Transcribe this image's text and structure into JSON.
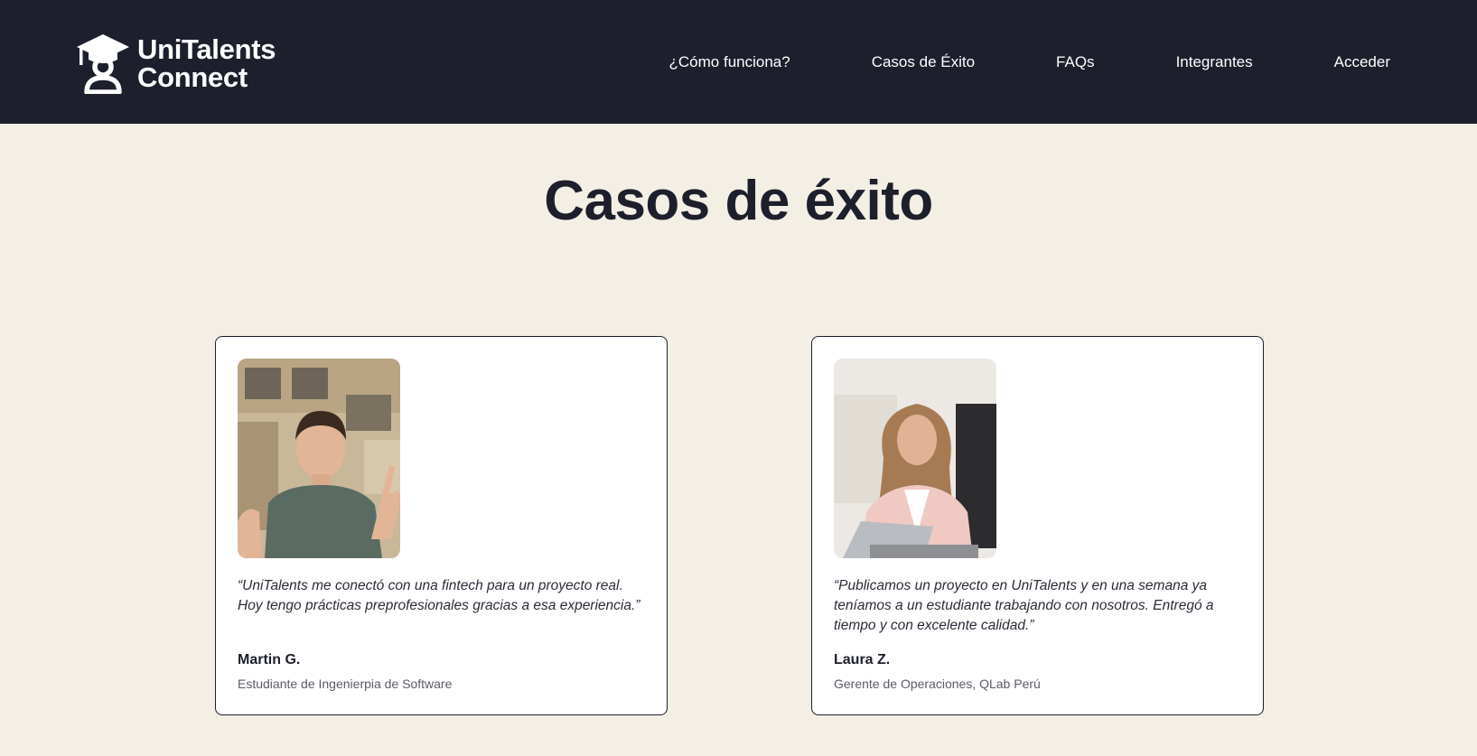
{
  "brand": {
    "name_line1": "UniTalents",
    "name_line2": "Connect"
  },
  "nav": {
    "items": [
      {
        "label": "¿Cómo funciona?"
      },
      {
        "label": "Casos de Éxito"
      },
      {
        "label": "FAQs"
      },
      {
        "label": "Integrantes"
      },
      {
        "label": "Acceder"
      }
    ]
  },
  "page": {
    "title": "Casos de éxito"
  },
  "testimonials": [
    {
      "quote": "“UniTalents me conectó con una fintech para un proyecto real. Hoy tengo prácticas preprofesionales gracias a esa experiencia.”",
      "name": "Martin G.",
      "role": "Estudiante de Ingenierpia de Software"
    },
    {
      "quote": "“Publicamos un proyecto en UniTalents y en una semana ya teníamos a un estudiante trabajando con nosotros. Entregó a tiempo y con excelente calidad.”",
      "name": "Laura Z.",
      "role": "Gerente de Operaciones, QLab Perú"
    }
  ],
  "colors": {
    "navbar_bg": "#1d1f2c",
    "page_bg": "#f4efe4",
    "card_bg": "#ffffff",
    "text_dark": "#1d1f2c"
  }
}
